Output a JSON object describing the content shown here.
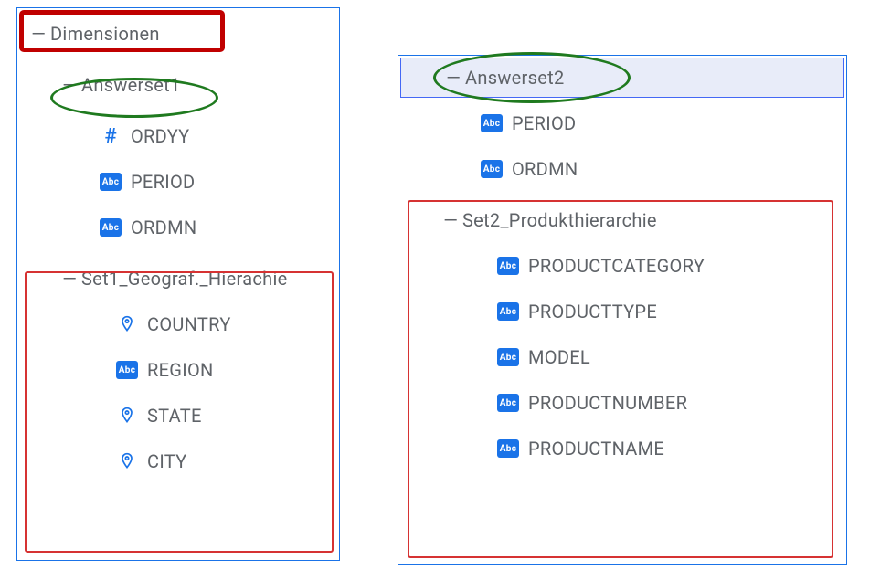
{
  "left": {
    "title": "Dimensionen",
    "set": "Answerset1",
    "fields": [
      {
        "icon": "hash",
        "label": "ORDYY"
      },
      {
        "icon": "abc",
        "label": "PERIOD"
      },
      {
        "icon": "abc",
        "label": "ORDMN"
      }
    ],
    "hier": {
      "title": "Set1_Geograf._Hierachie",
      "items": [
        {
          "icon": "geo",
          "label": "COUNTRY"
        },
        {
          "icon": "abc",
          "label": "REGION"
        },
        {
          "icon": "geo",
          "label": "STATE"
        },
        {
          "icon": "geo",
          "label": "CITY"
        }
      ]
    }
  },
  "right": {
    "set": "Answerset2",
    "fields": [
      {
        "icon": "abc",
        "label": "PERIOD"
      },
      {
        "icon": "abc",
        "label": "ORDMN"
      }
    ],
    "hier": {
      "title": "Set2_Produkthierarchie",
      "items": [
        {
          "icon": "abc",
          "label": "PRODUCTCATEGORY"
        },
        {
          "icon": "abc",
          "label": "PRODUCTTYPE"
        },
        {
          "icon": "abc",
          "label": "MODEL"
        },
        {
          "icon": "abc",
          "label": "PRODUCTNUMBER"
        },
        {
          "icon": "abc",
          "label": "PRODUCTNAME"
        }
      ]
    }
  }
}
